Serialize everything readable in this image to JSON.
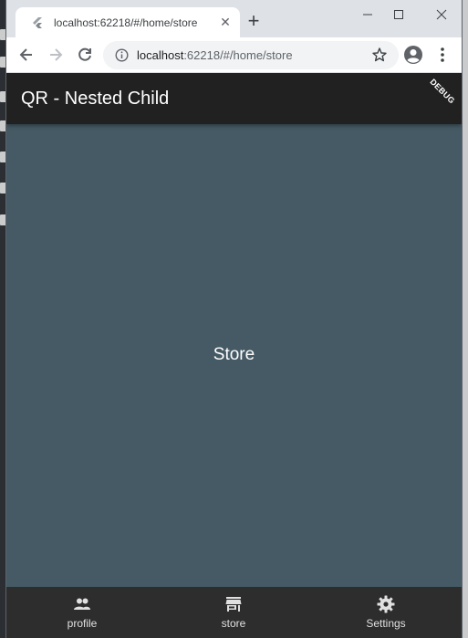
{
  "browser": {
    "tab_title": "localhost:62218/#/home/store",
    "new_tab_label": "+",
    "url_host": "localhost",
    "url_rest": ":62218/#/home/store"
  },
  "app": {
    "title": "QR - Nested Child",
    "debug_banner": "DEBUG",
    "body_text": "Store",
    "nav": [
      {
        "label": "profile",
        "icon": "people-icon"
      },
      {
        "label": "store",
        "icon": "store-icon"
      },
      {
        "label": "Settings",
        "icon": "gear-icon"
      }
    ]
  },
  "colors": {
    "appbar": "#212121",
    "body": "#455a64",
    "bottom_nav": "#2d2d2d"
  }
}
